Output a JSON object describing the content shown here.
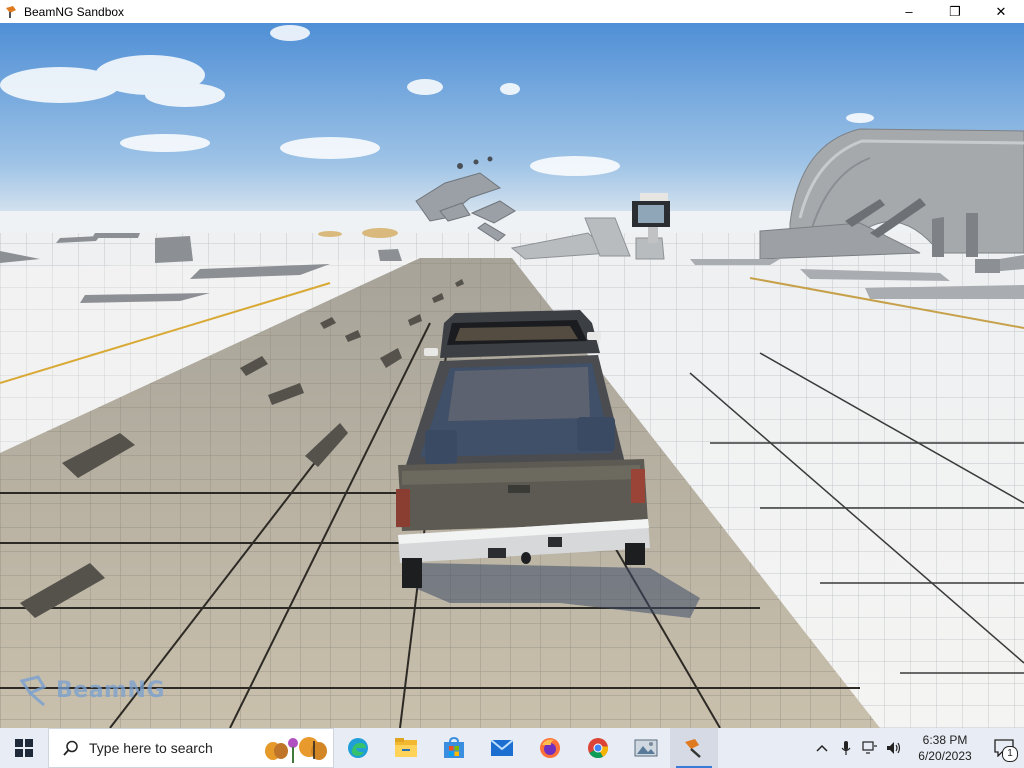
{
  "window": {
    "title": "BeamNG Sandbox",
    "minimize_glyph": "–",
    "maximize_glyph": "❐",
    "close_glyph": "✕"
  },
  "game": {
    "watermark_text": "BeamNG"
  },
  "taskbar": {
    "search_placeholder": "Type here to search",
    "apps": [
      {
        "name": "edge-icon"
      },
      {
        "name": "file-explorer-icon"
      },
      {
        "name": "microsoft-store-icon"
      },
      {
        "name": "mail-icon"
      },
      {
        "name": "firefox-icon"
      },
      {
        "name": "chrome-icon"
      },
      {
        "name": "photos-icon"
      },
      {
        "name": "beamng-icon"
      }
    ],
    "clock_time": "6:38 PM",
    "clock_date": "6/20/2023",
    "notification_count": "1",
    "colors": {
      "accent": "#3a7bd5",
      "taskbar_bg": "#e8ecf4"
    }
  }
}
